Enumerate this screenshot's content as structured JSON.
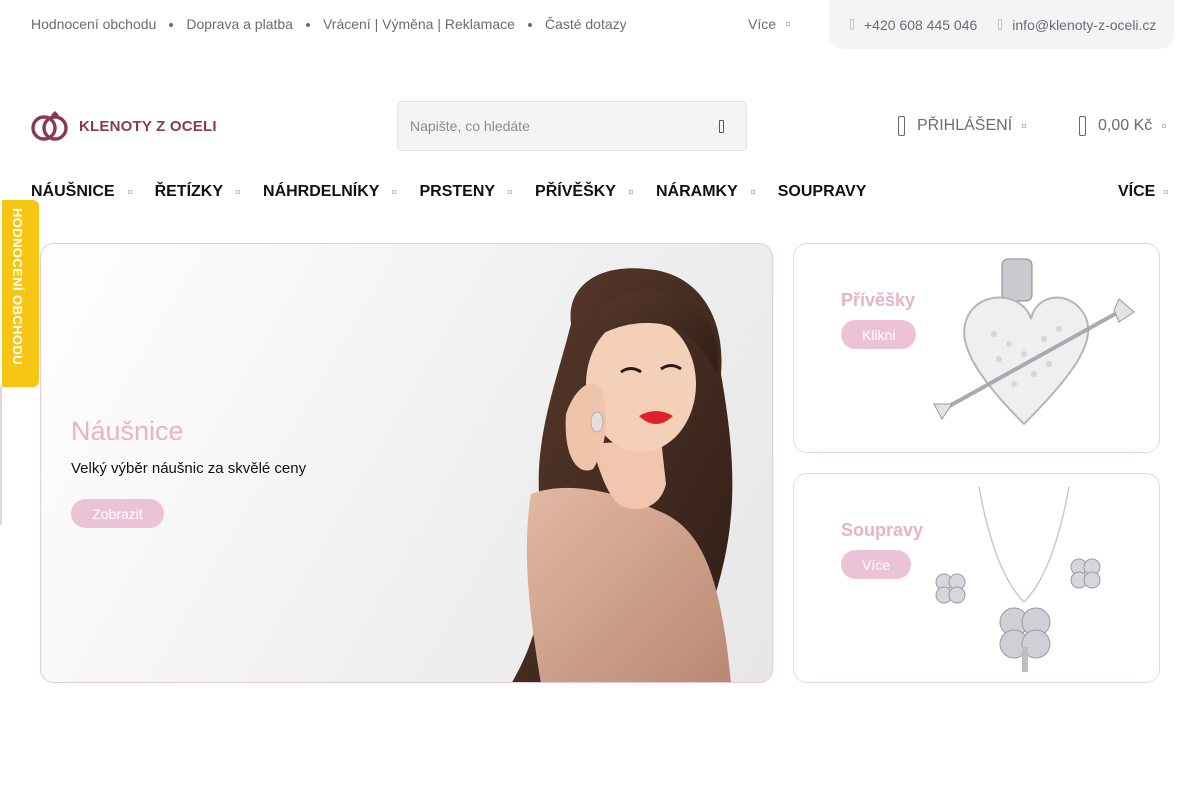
{
  "topbar": {
    "links": [
      "Hodnocení obchodu",
      "Doprava a platba",
      "Vrácení | Výměna | Reklamace",
      "Časté dotazy"
    ],
    "more": "Více",
    "phone": "+420 608 445 046",
    "email": "info@klenoty-z-oceli.cz"
  },
  "header": {
    "logo_text": "KLENOTY Z OCELI",
    "search_placeholder": "Napište, co hledáte",
    "login": "PŘIHLÁŠENÍ",
    "cart": "0,00 Kč"
  },
  "nav": {
    "items": [
      "NÁUŠNICE",
      "ŘETÍZKY",
      "NÁHRDELNÍKY",
      "PRSTENY",
      "PŘÍVĚŠKY",
      "NÁRAMKY",
      "SOUPRAVY"
    ],
    "more": "VÍCE"
  },
  "sidetab": {
    "label": "HODNOCENÍ OBCHODU"
  },
  "hero": {
    "title": "Náušnice",
    "subtitle": "Velký výběr náušnic za skvělé ceny",
    "button": "Zobrazit"
  },
  "cards": [
    {
      "title": "Přívěšky",
      "button": "Klikni"
    },
    {
      "title": "Soupravy",
      "button": "Více"
    }
  ],
  "colors": {
    "accent_pink": "#e8b2c9",
    "button_pink": "#ecc3d6",
    "logo": "#8a3a4e",
    "sidetab": "#f7c513"
  }
}
